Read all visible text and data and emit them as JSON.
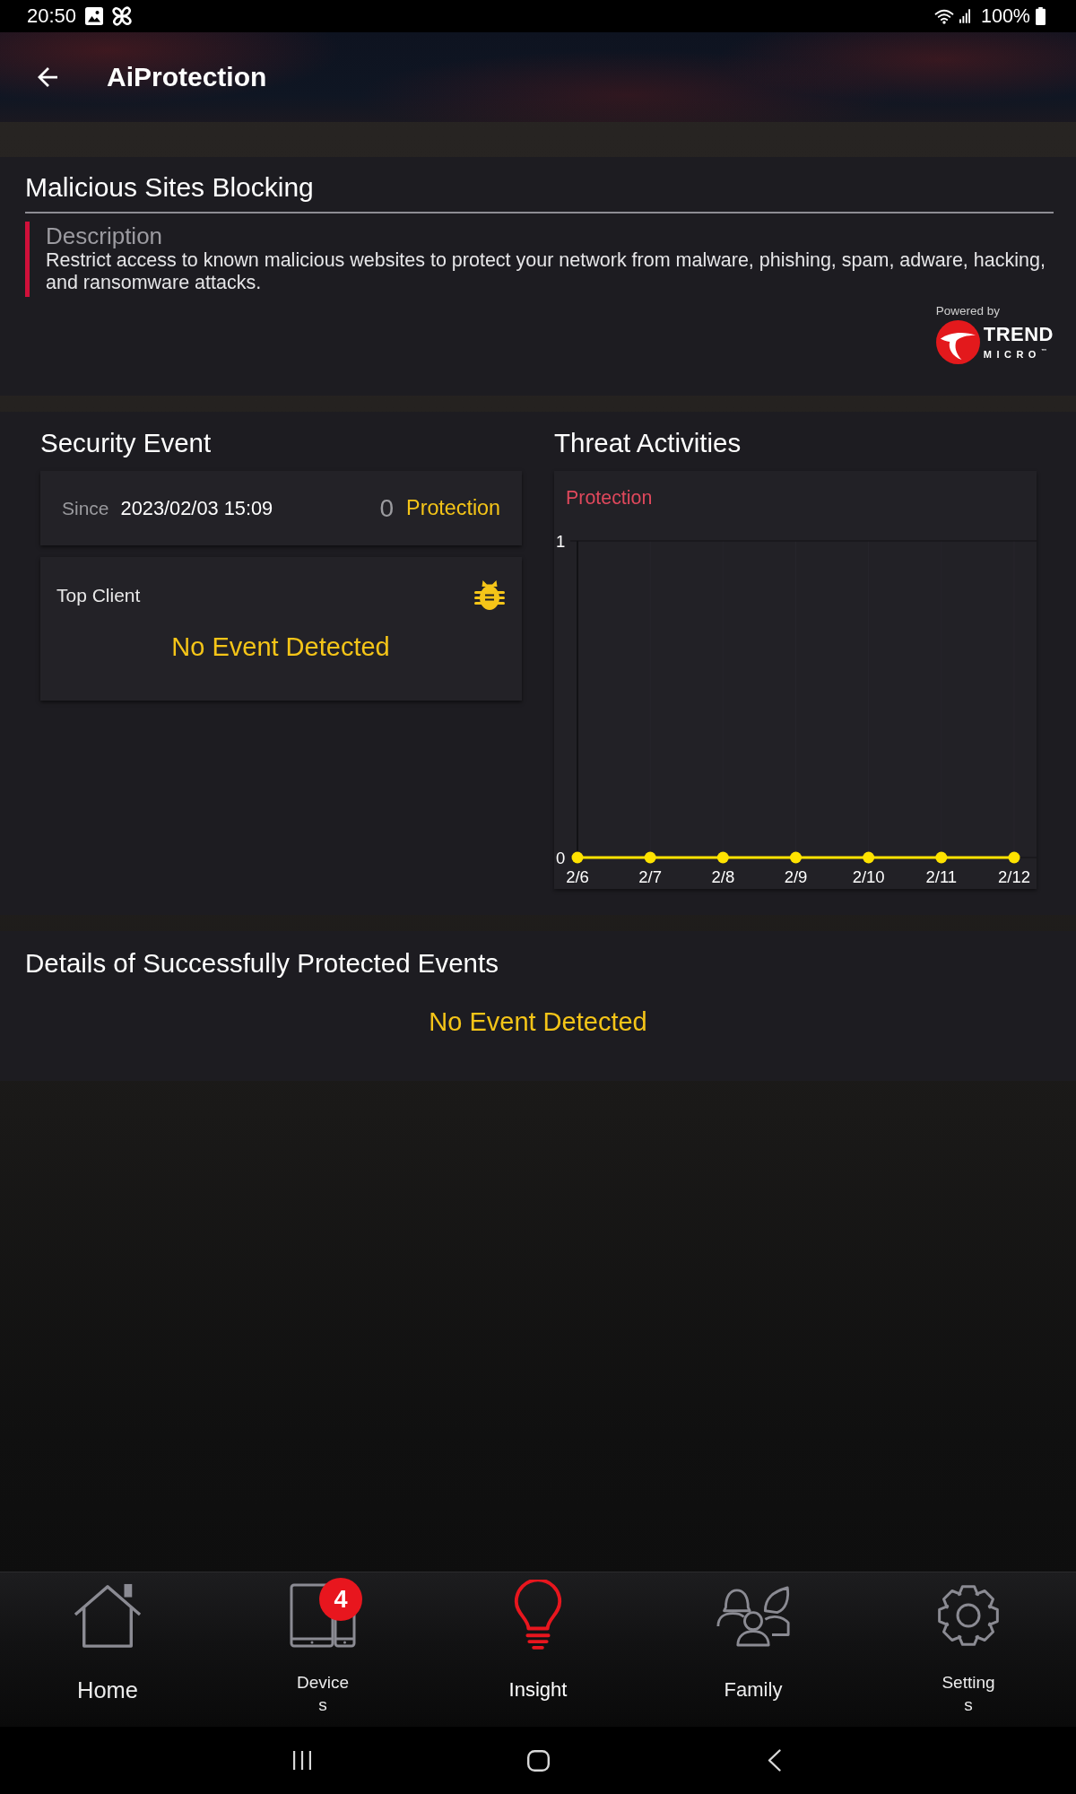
{
  "status_bar": {
    "time": "20:50",
    "battery": "100%"
  },
  "app_bar": {
    "title": "AiProtection"
  },
  "feature": {
    "title": "Malicious Sites Blocking",
    "description_label": "Description",
    "description": "Restrict access to known malicious websites to protect your network from malware, phishing, spam, adware, hacking, and ransomware attacks.",
    "powered_by": "Powered by",
    "logo": {
      "line_1": "TREND",
      "line_2": "MICRO$^{™}$"
    }
  },
  "security_event": {
    "heading": "Security Event",
    "since_label": "Since",
    "since_value": "2023/02/03 15:09",
    "count": "0",
    "count_label": "Protection",
    "top_client": {
      "title": "Top Client",
      "message": "No Event Detected"
    }
  },
  "threat_activities": {
    "heading": "Threat Activities",
    "chart_data": {
      "type": "line",
      "categories": [
        "2/6",
        "2/7",
        "2/8",
        "2/9",
        "2/10",
        "2/11",
        "2/12"
      ],
      "series": [
        {
          "name": "Protection",
          "color": "#ffe300",
          "marker": "circle",
          "values": [
            0,
            0,
            0,
            0,
            0,
            0,
            0
          ]
        }
      ],
      "ylim": [
        0,
        1
      ],
      "yticks": [
        0,
        1
      ]
    }
  },
  "protected_events": {
    "heading": "Details of Successfully Protected Events",
    "message": "No Event Detected"
  },
  "bottom_nav": [
    {
      "label": "Home",
      "selected": false
    },
    {
      "label": "Devices",
      "selected": false,
      "badge": "4"
    },
    {
      "label": "Insight",
      "selected": true
    },
    {
      "label": "Family",
      "selected": false
    },
    {
      "label": "Settings",
      "selected": false
    }
  ]
}
